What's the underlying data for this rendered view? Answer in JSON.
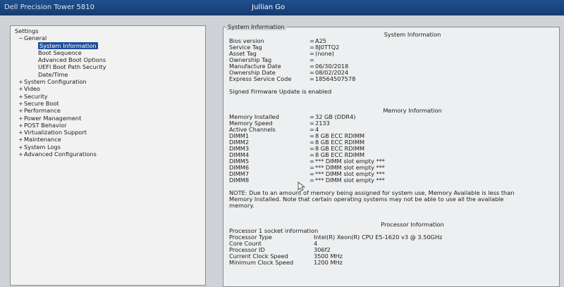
{
  "titlebar": {
    "app": "Dell Precision Tower 5810",
    "user": "Jullian Go"
  },
  "tree": {
    "root": "Settings",
    "general": {
      "label": "General",
      "children": [
        "System Information",
        "Boot Sequence",
        "Advanced Boot Options",
        "UEFI Boot Path Security",
        "Date/Time"
      ]
    },
    "items": [
      "System Configuration",
      "Video",
      "Security",
      "Secure Boot",
      "Performance",
      "Power Management",
      "POST Behavior",
      "Virtualization Support",
      "Maintenance",
      "System Logs",
      "Advanced Configurations"
    ]
  },
  "frame_title": "System Information",
  "system": {
    "title": "System Information",
    "rows": [
      {
        "k": "Bios version",
        "v": "A25"
      },
      {
        "k": "Service Tag",
        "v": "8J0TTQ2"
      },
      {
        "k": "Asset Tag",
        "v": "(none)"
      },
      {
        "k": "Ownership Tag",
        "v": ""
      },
      {
        "k": "Manufacture Date",
        "v": "06/30/2018"
      },
      {
        "k": "Ownership Date",
        "v": "08/02/2024"
      },
      {
        "k": "Express Service Code",
        "v": "18564507578"
      }
    ],
    "firmware_note": "Signed Firmware Update is enabled"
  },
  "memory": {
    "title": "Memory Information",
    "rows": [
      {
        "k": "Memory Installed",
        "v": "32 GB (DDR4)"
      },
      {
        "k": "Memory Speed",
        "v": "2133"
      },
      {
        "k": "Active Channels",
        "v": "4"
      },
      {
        "k": "DIMM1",
        "v": "8 GB ECC RDIMM"
      },
      {
        "k": "DIMM2",
        "v": "8 GB ECC RDIMM"
      },
      {
        "k": "DIMM3",
        "v": "8 GB ECC RDIMM"
      },
      {
        "k": "DIMM4",
        "v": "8 GB ECC RDIMM"
      },
      {
        "k": "DIMM5",
        "v": "*** DIMM slot empty ***"
      },
      {
        "k": "DIMM6",
        "v": "*** DIMM slot empty ***"
      },
      {
        "k": "DIMM7",
        "v": "*** DIMM slot empty ***"
      },
      {
        "k": "DIMM8",
        "v": "*** DIMM slot empty ***"
      }
    ],
    "note": "NOTE: Due to an amount of memory being assigned for system use, Memory Available is less than Memory Installed. Note that certain operating systems may not be able to use all the available memory."
  },
  "processor": {
    "title": "Processor Information",
    "socket": "Processor 1 socket information",
    "rows": [
      {
        "k": "Processor Type",
        "v": "Intel(R) Xeon(R) CPU E5-1620 v3 @ 3.50GHz"
      },
      {
        "k": "Core Count",
        "v": "4"
      },
      {
        "k": "Processor ID",
        "v": "306f2"
      },
      {
        "k": "Current Clock Speed",
        "v": "3500 MHz"
      },
      {
        "k": "Minimum Clock Speed",
        "v": "1200 MHz"
      }
    ]
  }
}
